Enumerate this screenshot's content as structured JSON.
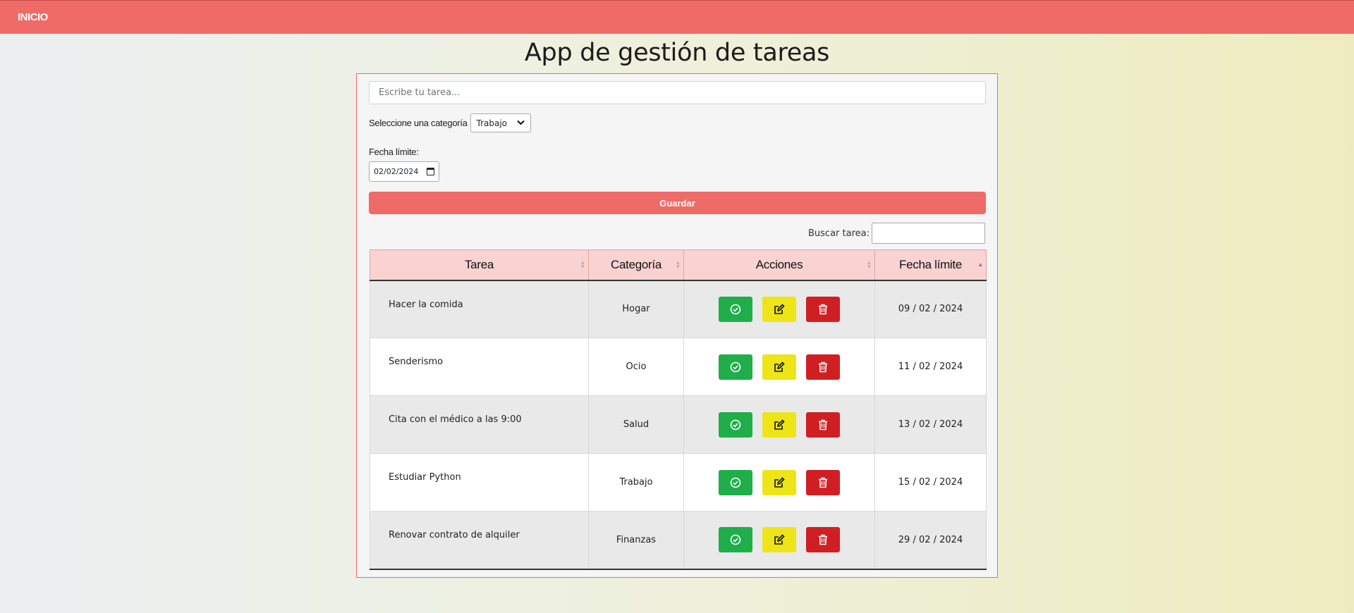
{
  "nav": {
    "home_label": "INICIO"
  },
  "page": {
    "title": "App de gestión de tareas"
  },
  "form": {
    "task_placeholder": "Escribe tu tarea...",
    "category_label": "Seleccione una categoría",
    "category_selected": "Trabajo",
    "deadline_label": "Fecha límite:",
    "deadline_value": "02/02/2024",
    "save_label": "Guardar"
  },
  "search": {
    "label": "Buscar tarea:",
    "value": ""
  },
  "table": {
    "headers": [
      "Tarea",
      "Categoría",
      "Acciones",
      "Fecha límite"
    ],
    "sorted_column": "Fecha límite",
    "rows": [
      {
        "task": "Hacer la comida",
        "category": "Hogar",
        "deadline": "09 / 02 / 2024"
      },
      {
        "task": "Senderismo",
        "category": "Ocio",
        "deadline": "11 / 02 / 2024"
      },
      {
        "task": "Cita con el médico a las 9:00",
        "category": "Salud",
        "deadline": "13 / 02 / 2024"
      },
      {
        "task": "Estudiar Python",
        "category": "Trabajo",
        "deadline": "15 / 02 / 2024"
      },
      {
        "task": "Renovar contrato de alquiler",
        "category": "Finanzas",
        "deadline": "29 / 02 / 2024"
      }
    ],
    "row_actions": [
      {
        "name": "complete-button",
        "icon": "check-circle-icon",
        "color": "#1fae4a"
      },
      {
        "name": "edit-button",
        "icon": "edit-icon",
        "color": "#ede517"
      },
      {
        "name": "delete-button",
        "icon": "trash-icon",
        "color": "#d01f23"
      }
    ]
  },
  "colors": {
    "accent": "#ef6b67",
    "header_bg": "#f8d3d2",
    "success": "#1fae4a",
    "warning": "#ede517",
    "danger": "#d01f23"
  }
}
